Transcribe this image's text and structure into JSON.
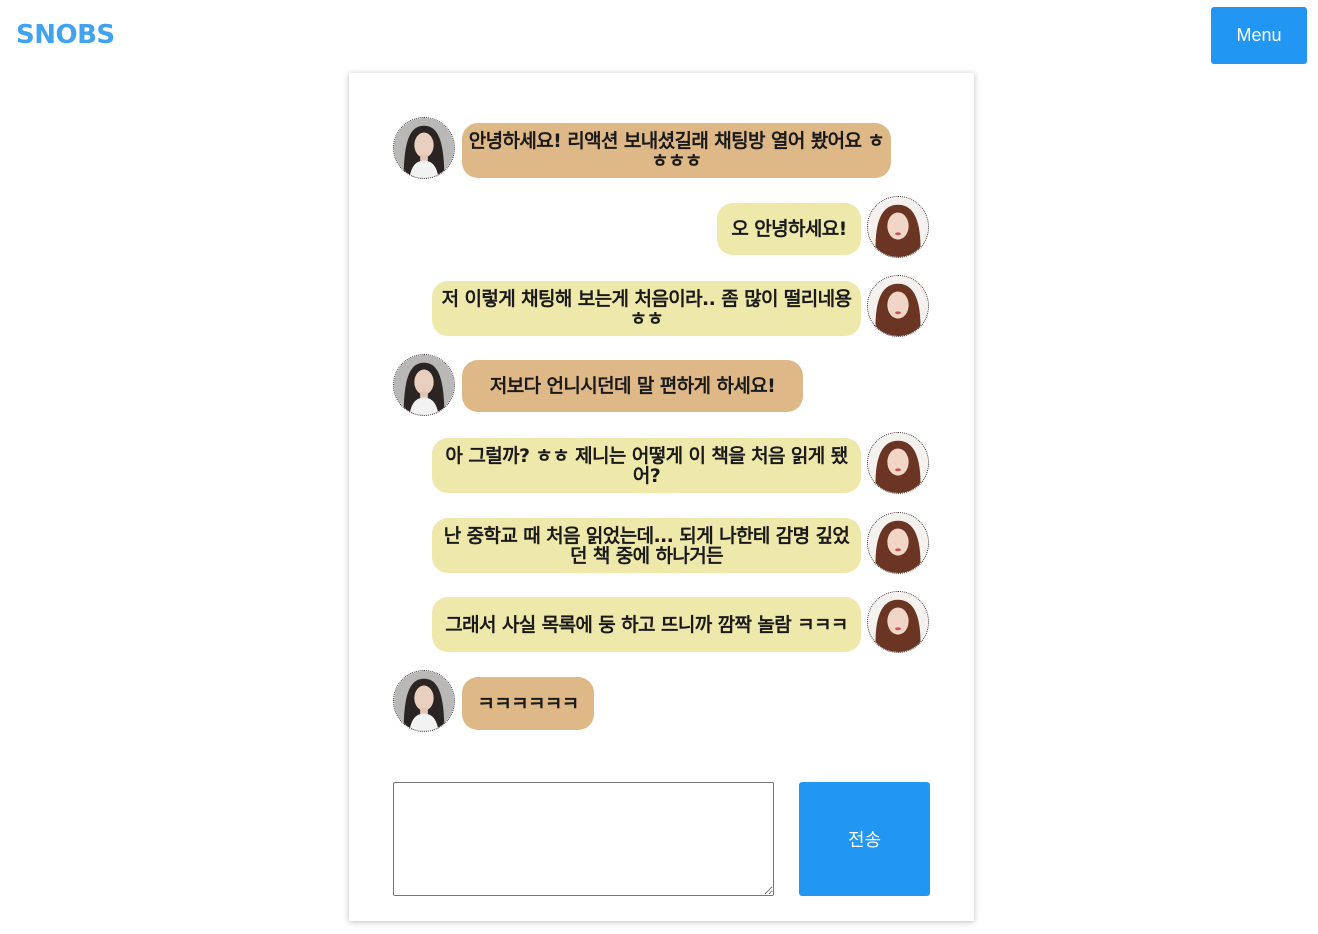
{
  "header": {
    "logo": "SNOBS",
    "menu_label": "Menu"
  },
  "chat": {
    "messages": [
      {
        "sender": "other",
        "text": "안녕하세요! 리액션 보내셨길래 채팅방 열어 봤어요 ㅎㅎㅎㅎ"
      },
      {
        "sender": "me",
        "text": "오 안녕하세요!"
      },
      {
        "sender": "me",
        "text": "저 이렇게 채팅해 보는게 처음이라.. 좀 많이 떨리네용 ㅎㅎ"
      },
      {
        "sender": "other",
        "text": "저보다 언니시던데 말 편하게 하세요!"
      },
      {
        "sender": "me",
        "text": "아 그럴까? ㅎㅎ 제니는 어떻게 이 책을 처음 읽게 됐어?"
      },
      {
        "sender": "me",
        "text": "난 중학교 때 처음 읽었는데... 되게 나한테 감명 깊었던 책 중에 하나거든"
      },
      {
        "sender": "me",
        "text": "그래서 사실 목록에 둥 하고 뜨니까 깜짝 놀람 ㅋㅋㅋ"
      },
      {
        "sender": "other",
        "text": "ㅋㅋㅋㅋㅋㅋ"
      }
    ],
    "input_value": "",
    "send_label": "전송"
  },
  "colors": {
    "accent": "#2196f3",
    "logo": "#3fa3f2",
    "bubble_other": "#deb887",
    "bubble_me": "#eee8aa"
  },
  "icons": {
    "avatar_other": "woman-dark-hair-avatar",
    "avatar_me": "woman-auburn-hair-avatar"
  }
}
